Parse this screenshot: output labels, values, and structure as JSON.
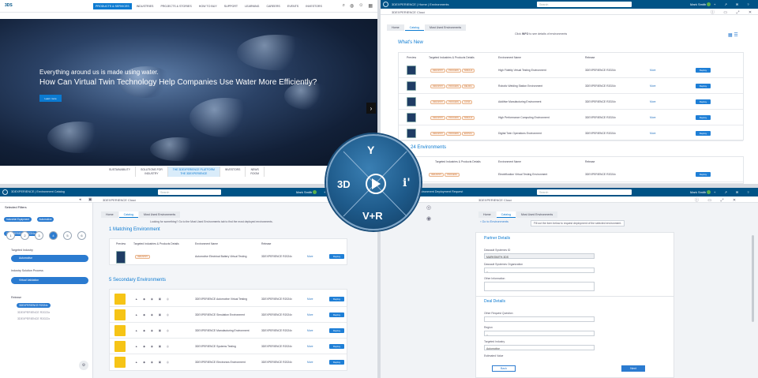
{
  "q1": {
    "logo": "3DS",
    "nav": [
      "PRODUCTS & SERVICES",
      "INDUSTRIES",
      "PROJECTS & STORIES",
      "HOW TO BUY",
      "SUPPORT",
      "LEARNING",
      "CAREERS",
      "EVENTS",
      "INVESTORS"
    ],
    "hero_sub": "Everything around us is made using water.",
    "hero_title": "How Can Virtual Twin Technology Help Companies Use Water More Efficiently?",
    "hero_btn": "Learn more",
    "footer": [
      {
        "a": "SUSTAINABILITY",
        "b": ""
      },
      {
        "a": "SOLUTIONS FOR",
        "b": "INDUSTRY"
      },
      {
        "a": "THE 3DEXPERIENCE PLATFORM",
        "b": "THE 3DEXPERIENCE"
      },
      {
        "a": "INVESTORS",
        "b": ""
      },
      {
        "a": "NEWS",
        "b": "ROOM"
      }
    ]
  },
  "q2": {
    "title": "3DEXPERIENCE | Home | Environments",
    "search_placeholder": "Search",
    "user": "Mark Smith",
    "bar_title": "3DEXPERIENCE Cloud",
    "tabs": [
      "Home",
      "Catalog",
      "Most Used Environments"
    ],
    "whats_new": "What's New",
    "cols": [
      "Preview",
      "Targeted Industries & Products Details",
      "Environment Name",
      "Release",
      ""
    ],
    "rows": [
      {
        "name": "High Fidelity Virtual Testing Environment",
        "rel": "3DEXPERIENCE R2024x",
        "btn": "Deploy",
        "link": "More"
      },
      {
        "name": "Robotic Welding Station Environment",
        "rel": "3DEXPERIENCE R2024x",
        "btn": "Deploy",
        "link": "More"
      },
      {
        "name": "Additive Manufacturing Environment",
        "rel": "3DEXPERIENCE R2024x",
        "btn": "Deploy",
        "link": "More"
      },
      {
        "name": "High Performance Computing Environment",
        "rel": "3DEXPERIENCE R2024x",
        "btn": "Deploy",
        "link": "More"
      },
      {
        "name": "Digital Twin Operations Environment",
        "rel": "3DEXPERIENCE R2024x",
        "btn": "Deploy",
        "link": "More"
      }
    ],
    "count_title": "24 Environments",
    "last_row": {
      "name": "Electrification Virtual Testing Environment",
      "rel": "3DEXPERIENCE R2024x",
      "btn": "Deploy"
    }
  },
  "q3": {
    "title": "3DEXPERIENCE | Environment Catalog",
    "search_placeholder": "Search",
    "user": "Mark Smith",
    "bar_title": "3DEXPERIENCE Cloud",
    "tabs": [
      "Home",
      "Catalog",
      "Most Used Environments"
    ],
    "filters_title": "Selected Filters",
    "chips": [
      "Industrial Equipment",
      "Automotive",
      "3DEXPERIENCE R2024x"
    ],
    "circles": [
      "1",
      "2",
      "3",
      "4",
      "5",
      "6"
    ],
    "group1": "Targeted Industry",
    "group1_item": "Automotive",
    "group2": "Industry Solution Process",
    "group2_item": "Virtual Validation",
    "group3": "Release",
    "group3_items": [
      "3DEXPERIENCE R2024x",
      "3DEXPERIENCE R2023x",
      "3DEXPERIENCE R2022x"
    ],
    "banner": "Looking for something? Go to the Most Used Environments tab to find the most deployed environments.",
    "match_title": "1 Matching Environment",
    "match_cols": [
      "Preview",
      "Targeted Industries & Products Details",
      "Environment Name",
      "Release"
    ],
    "match_row": {
      "name": "Automotive Electrical Battery Virtual Testing",
      "rel": "3DEXPERIENCE R2024x",
      "btn": "Deploy",
      "link": "More"
    },
    "sec_title": "5 Secondary Environments",
    "sec_rows": [
      {
        "name": "3DEXPERIENCE Automotive Virtual Testing",
        "rel": "3DEXPERIENCE R2024x",
        "btn": "Deploy",
        "link": "More"
      },
      {
        "name": "3DEXPERIENCE Simulation Environment",
        "rel": "3DEXPERIENCE R2024x",
        "btn": "Deploy",
        "link": "More"
      },
      {
        "name": "3DEXPERIENCE Manufacturing Environment",
        "rel": "3DEXPERIENCE R2024x",
        "btn": "Deploy",
        "link": "More"
      },
      {
        "name": "3DEXPERIENCE Systems Testing",
        "rel": "3DEXPERIENCE R2024x",
        "btn": "Deploy",
        "link": "More"
      },
      {
        "name": "3DEXPERIENCE Electronics Environment",
        "rel": "3DEXPERIENCE R2024x",
        "btn": "Deploy",
        "link": "More"
      }
    ]
  },
  "q4": {
    "title": "3DEXPERIENCE | Environment Deployment Request",
    "search_placeholder": "Search",
    "user": "Mark Smith",
    "bar_title": "3DEXPERIENCE Cloud",
    "tabs": [
      "Home",
      "Catalog",
      "Most Used Environments"
    ],
    "back": "Go to Environments",
    "banner": "Fill out the form below to request deployment of the selected environment.",
    "section1": "Partner Details",
    "f1": "Dassault Systemes ID",
    "f1v": "MARKSMITH-3DS",
    "f2": "Dassault Systemes Organization",
    "f2v": "--",
    "f3": "Other Information",
    "section2": "Deal Details",
    "f4": "Other Request Question",
    "f5": "Region",
    "f5v": "--",
    "f6": "Targeted Industry",
    "f6v": "Automotive",
    "f7": "Estimated Value",
    "btn_back": "Back",
    "btn_next": "Next"
  },
  "badge": {
    "a": "3D",
    "b": "V+R",
    "c": "i'",
    "d": "Y"
  }
}
